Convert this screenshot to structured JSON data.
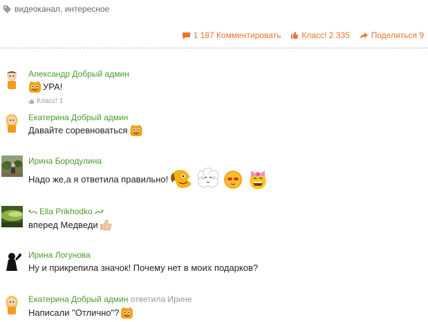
{
  "tags": {
    "text": "видеоканал, интересное",
    "icon": "tag-icon"
  },
  "actions": {
    "comments": "1 187 Комментировать",
    "class": "Класс! 2 335",
    "share": "Поделиться 9",
    "accent_color": "#eb722e"
  },
  "comments": [
    {
      "author": "Александр Добрый админ",
      "text": "УРА!",
      "like": "Класс! 1",
      "avatar": "boy-avatar"
    },
    {
      "author": "Екатерина Добрый админ",
      "text": "Давайте соревноваться",
      "avatar": "girl-avatar"
    },
    {
      "author": "Ирина Бородулина",
      "text": "Надо же,а я ответила правильно!",
      "avatar": "photo-avatar"
    },
    {
      "author": "Ella Prikhodko",
      "text": "вперед Медведи",
      "avatar": "photo-avatar"
    },
    {
      "author": "Ирина Логунова",
      "text": "Ну и прикрепила значок! Почему нет в моих подарков?",
      "avatar": "silhouette-avatar"
    },
    {
      "author": "Екатерина Добрый админ",
      "reply": "ответила Ирине",
      "text": "Написали \"Отлично\"?",
      "avatar": "girl-avatar"
    }
  ],
  "colors": {
    "author": "#4c9a2a",
    "muted": "#999999"
  }
}
